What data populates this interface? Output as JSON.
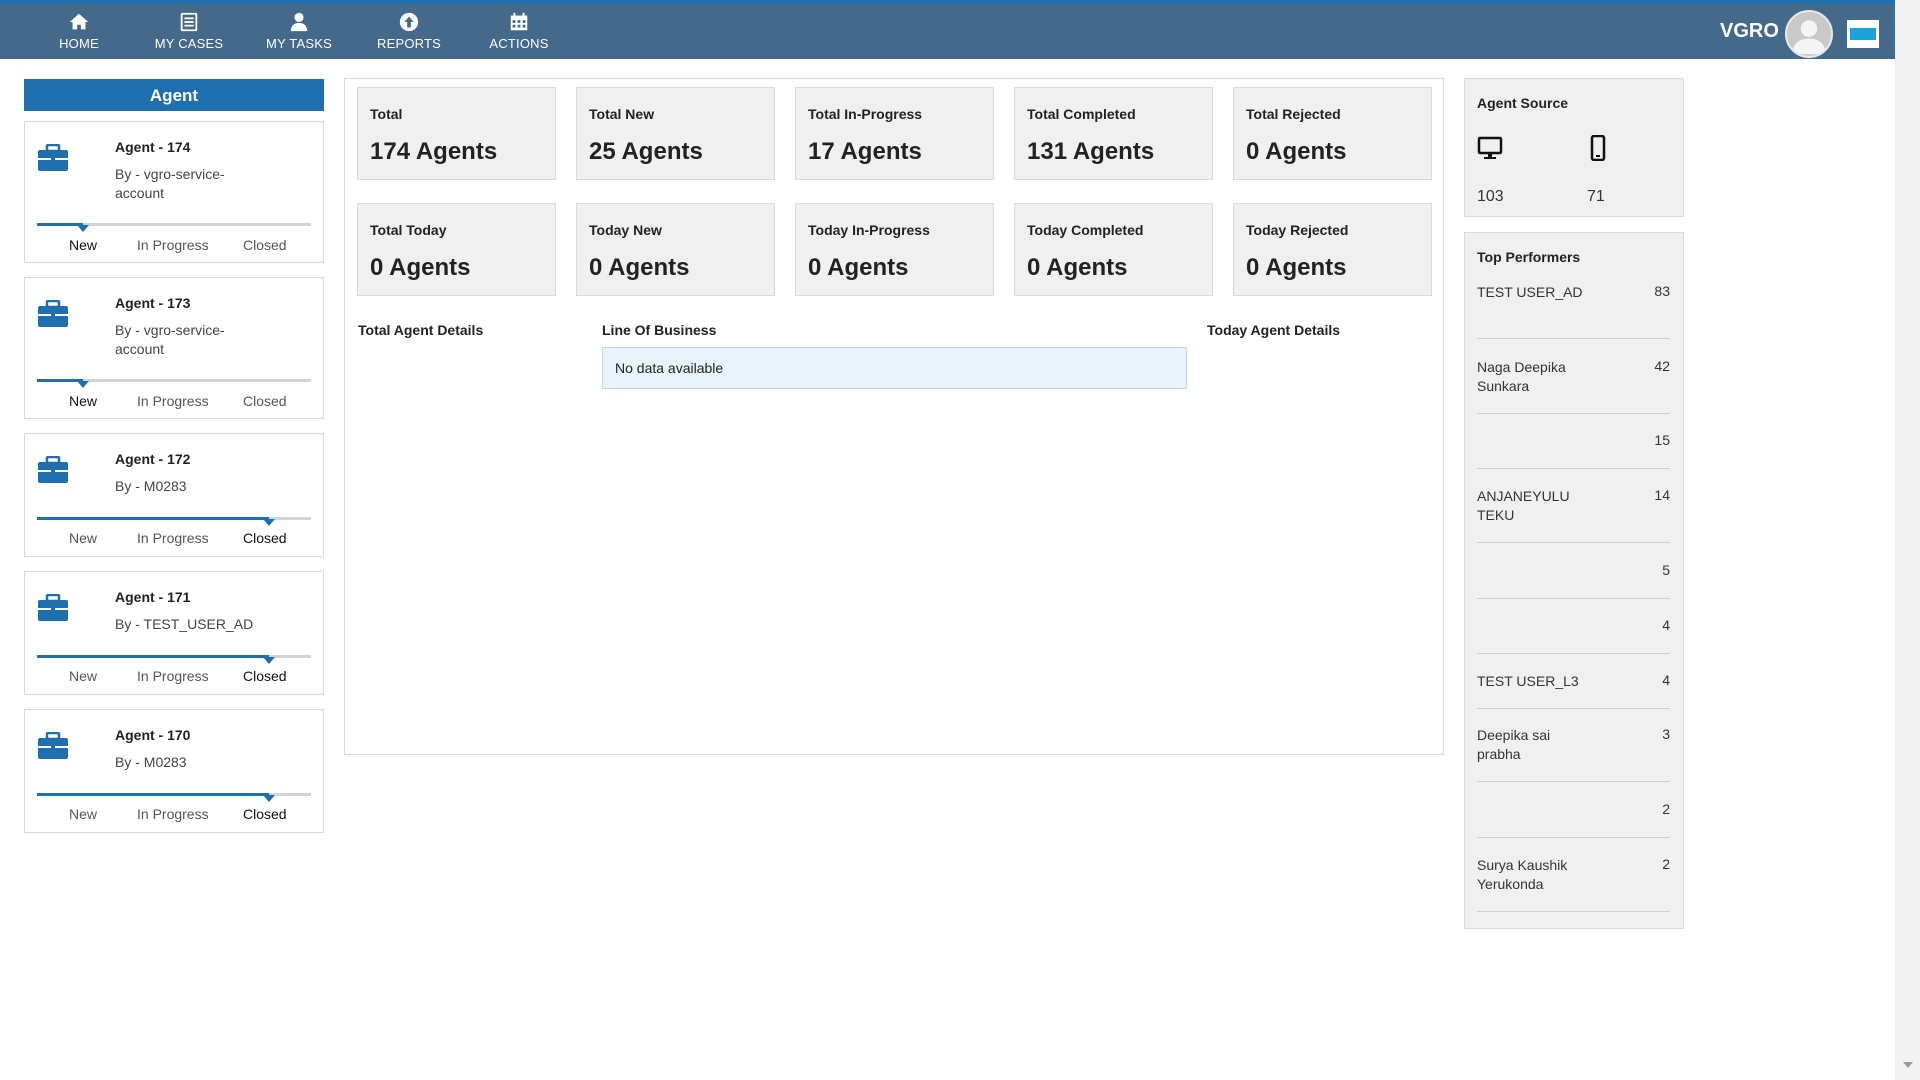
{
  "nav": {
    "items": [
      {
        "label": "HOME",
        "icon": "home-icon"
      },
      {
        "label": "MY CASES",
        "icon": "list-icon"
      },
      {
        "label": "MY TASKS",
        "icon": "user-icon"
      },
      {
        "label": "REPORTS",
        "icon": "upload-circle-icon"
      },
      {
        "label": "ACTIONS",
        "icon": "calendar-icon"
      }
    ],
    "brand": "VGRO"
  },
  "colors": {
    "topbar": "#44698b",
    "accent": "#1f6fae",
    "panel": "#f0f0f0"
  },
  "agents": {
    "header": "Agent",
    "stage_labels": {
      "new": "New",
      "in_progress": "In Progress",
      "closed": "Closed"
    },
    "cards": [
      {
        "title": "Agent - 174",
        "by": "By - vgro-service-account",
        "stage": "New"
      },
      {
        "title": "Agent - 173",
        "by": "By - vgro-service-account",
        "stage": "New"
      },
      {
        "title": "Agent - 172",
        "by": "By - M0283",
        "stage": "Closed"
      },
      {
        "title": "Agent - 171",
        "by": "By - TEST_USER_AD",
        "stage": "Closed"
      },
      {
        "title": "Agent - 170",
        "by": "By - M0283",
        "stage": "Closed"
      }
    ]
  },
  "stats": {
    "row1": [
      {
        "label": "Total",
        "value": "174 Agents"
      },
      {
        "label": "Total New",
        "value": "25 Agents"
      },
      {
        "label": "Total In-Progress",
        "value": "17 Agents"
      },
      {
        "label": "Total Completed",
        "value": "131 Agents"
      },
      {
        "label": "Total Rejected",
        "value": "0 Agents"
      }
    ],
    "row2": [
      {
        "label": "Total Today",
        "value": "0 Agents"
      },
      {
        "label": "Today New",
        "value": "0 Agents"
      },
      {
        "label": "Today In-Progress",
        "value": "0 Agents"
      },
      {
        "label": "Today Completed",
        "value": "0 Agents"
      },
      {
        "label": "Today Rejected",
        "value": "0 Agents"
      }
    ]
  },
  "sections": {
    "total_details": "Total Agent Details",
    "line_of_business": "Line Of Business",
    "today_details": "Today Agent Details",
    "no_data": "No data available"
  },
  "agent_source": {
    "title": "Agent Source",
    "desktop_count": "103",
    "mobile_count": "71"
  },
  "top_performers": {
    "title": "Top Performers",
    "rows": [
      {
        "name": "TEST USER_AD",
        "count": "83"
      },
      {
        "name": "Naga Deepika Sunkara",
        "count": "42"
      },
      {
        "name": "",
        "count": "15"
      },
      {
        "name": "ANJANEYULU TEKU",
        "count": "14"
      },
      {
        "name": "",
        "count": "5"
      },
      {
        "name": "",
        "count": "4"
      },
      {
        "name": "TEST USER_L3",
        "count": "4"
      },
      {
        "name": "Deepika sai prabha",
        "count": "3"
      },
      {
        "name": "",
        "count": "2"
      },
      {
        "name": "Surya Kaushik Yerukonda",
        "count": "2"
      }
    ]
  }
}
